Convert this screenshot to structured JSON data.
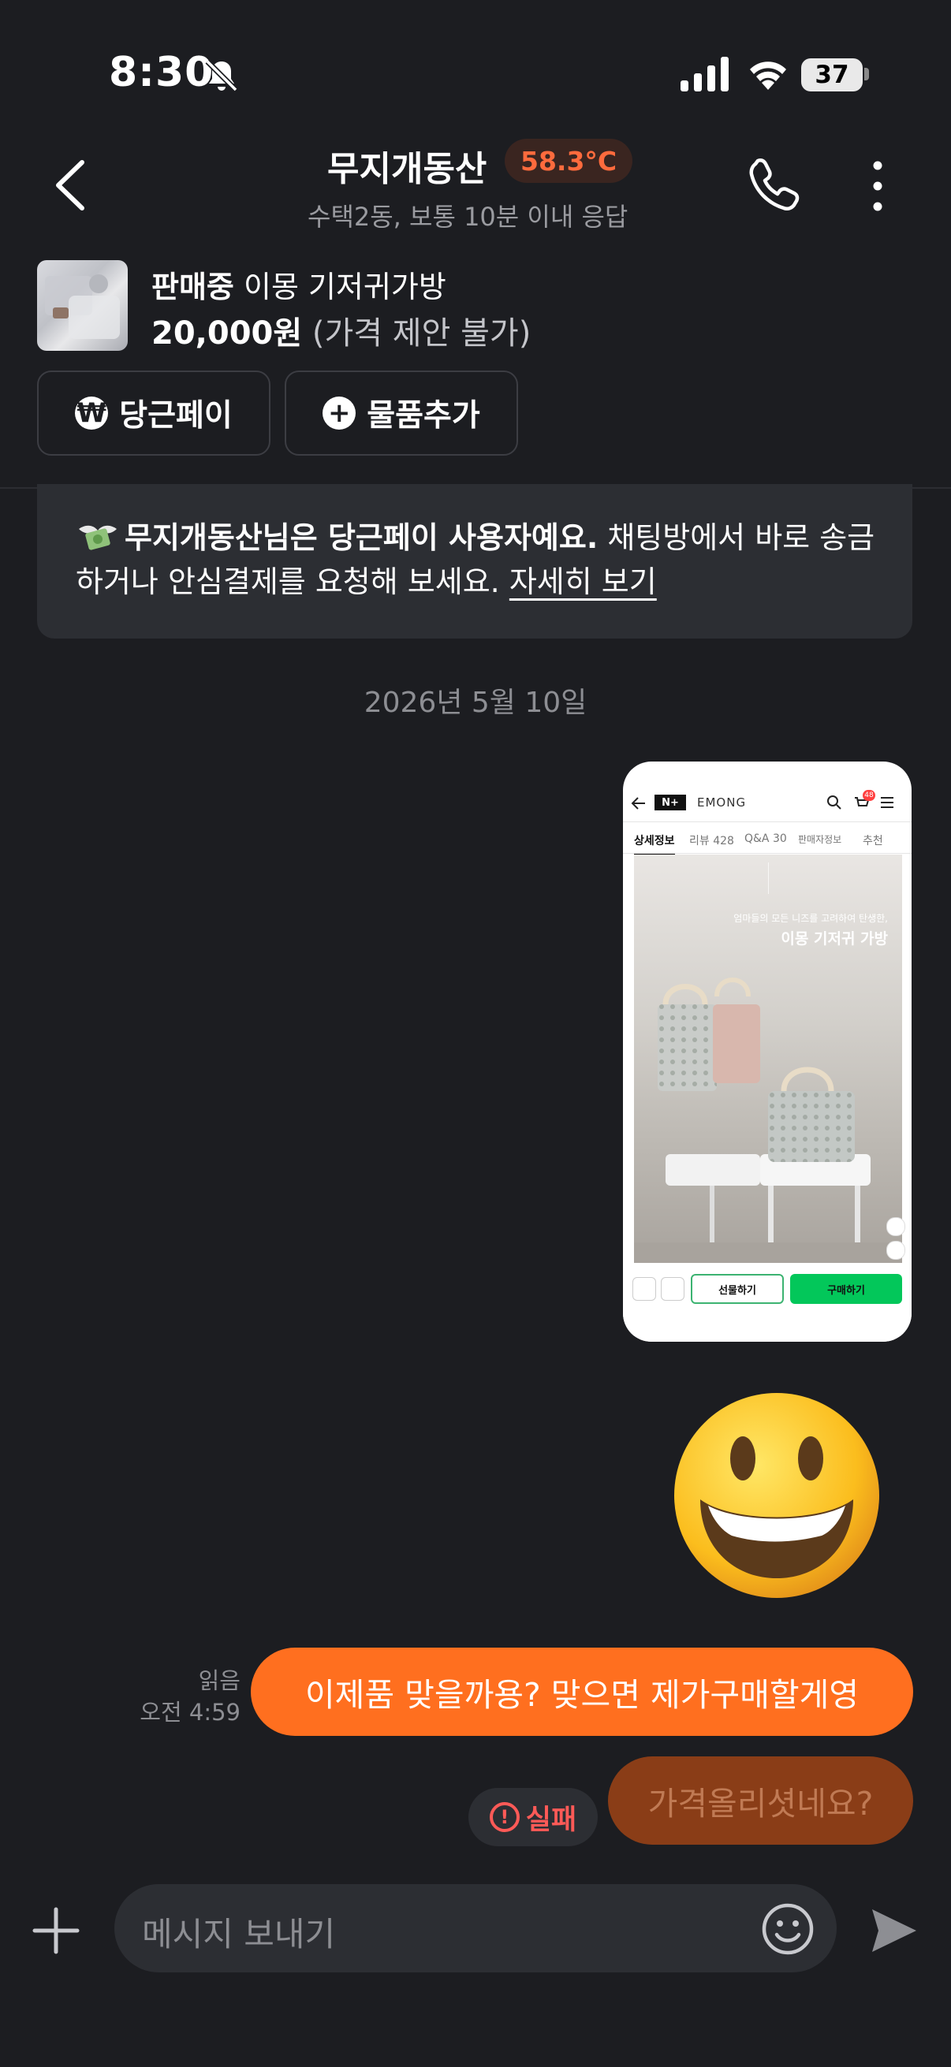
{
  "status_bar": {
    "time": "8:30",
    "battery": "37"
  },
  "header": {
    "title": "무지개동산",
    "temperature": "58.3°C",
    "subtitle": "수택2동, 보통 10분 이내 응답"
  },
  "product": {
    "status": "판매중",
    "name": "이몽 기저귀가방",
    "price": "20,000원",
    "price_note": "(가격 제안 불가)",
    "buttons": [
      "당근페이",
      "물품추가"
    ]
  },
  "notice": {
    "bold": "무지개동산님은 당근페이 사용자예요.",
    "text": " 채팅방에서 바로 송금하거나 안심결제를 요청해 보세요. ",
    "link": "자세히 보기"
  },
  "date_divider": "2026년 5월 10일",
  "shared_screenshot": {
    "tabs": [
      "상세정보",
      "리뷰 428",
      "Q&A 30",
      "판매자정보",
      "추천"
    ],
    "brand": "EMONG",
    "caption_small": "엄마들의 모든 니즈를 고려하여 탄생한,",
    "caption_big": "이몽 기저귀 가방",
    "gift_label": "선물하기",
    "buy_label": "구매하기",
    "cart_badge": "48"
  },
  "messages": [
    {
      "text": "이제품 맞을까용? 맞으면 제가구매할게영",
      "read": "읽음",
      "time": "오전 4:59"
    },
    {
      "text": "가격올리셧네요?",
      "status": "실패"
    }
  ],
  "input": {
    "placeholder": "메시지 보내기"
  },
  "colors": {
    "accent": "#ff6f1f",
    "background": "#1c1d21",
    "fail": "#ff5a57",
    "temperature": "#ff6b3d"
  }
}
